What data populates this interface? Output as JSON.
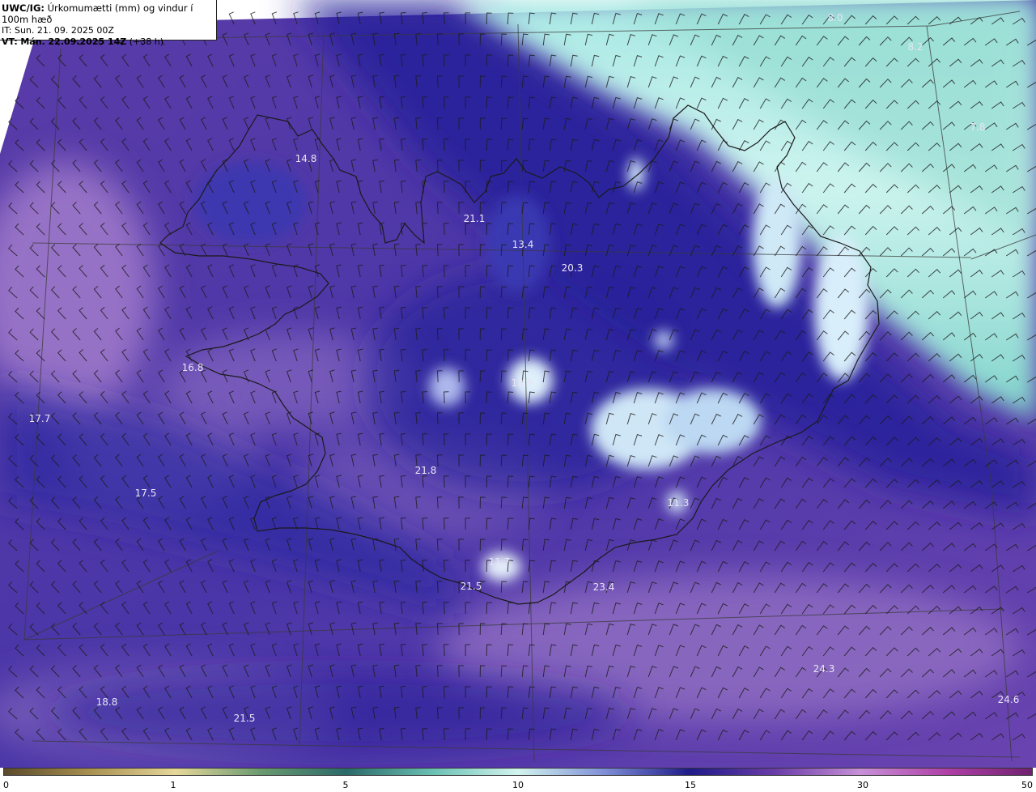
{
  "info": {
    "model": "UWC/IG:",
    "title": "Úrkomumætti (mm) og vindur í 100m hæð",
    "init_time": "IT: Sun. 21. 09. 2025 00Z",
    "valid_prefix": "VT:",
    "valid_time": "Mán. 22.09.2025 14Z",
    "lead": "(+38 h)"
  },
  "value_labels": [
    "8.0",
    "8.2",
    "7.8",
    "14.8",
    "21.1",
    "13.4",
    "20.3",
    "16.8",
    "17.7",
    "13.9",
    "21.8",
    "17.5",
    "11.3",
    "11.7",
    "21.5",
    "23.4",
    "24.3",
    "24.6",
    "18.8",
    "21.5"
  ],
  "colorbar": {
    "ticks": [
      "0",
      "1",
      "5",
      "10",
      "15",
      "30",
      "50"
    ],
    "colors": [
      "#5a4a2a",
      "#a89050",
      "#e6d79a",
      "#6a9a70",
      "#2a6a6a",
      "#6ac0b4",
      "#d2f4ee",
      "#8090d8",
      "#1e1a88",
      "#6a3ca8",
      "#c890d8",
      "#b040a8",
      "#702070"
    ]
  },
  "colors": {
    "land_outline": "#1a1a1a",
    "barb": "#1c1c1c",
    "grid": "#3a3a3a"
  }
}
